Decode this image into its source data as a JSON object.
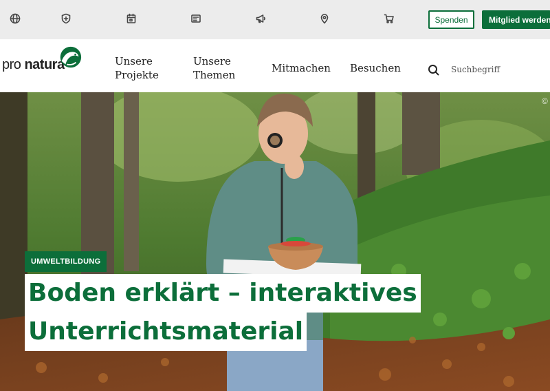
{
  "topbar": {
    "icons": [
      "globe-icon",
      "shield-icon",
      "calendar-icon",
      "newspaper-icon",
      "megaphone-icon",
      "location-pin-icon",
      "cart-icon"
    ],
    "donate_label": "Spenden",
    "member_label": "Mitglied werden",
    "accent": "#0c6e3a"
  },
  "logo": {
    "text_pre": "pro ",
    "text_bold": "natura"
  },
  "nav": {
    "items": [
      {
        "label": "Unsere\nProjekte"
      },
      {
        "label": "Unsere\nThemen"
      },
      {
        "label": "Mitmachen"
      },
      {
        "label": "Besuchen"
      }
    ],
    "search_placeholder": "Suchbegriff"
  },
  "hero": {
    "badge": "UMWELTBILDUNG",
    "title_line1": "Boden erklärt – interaktives",
    "title_line2": "Unterrichtsmaterial",
    "copyright": "©"
  }
}
